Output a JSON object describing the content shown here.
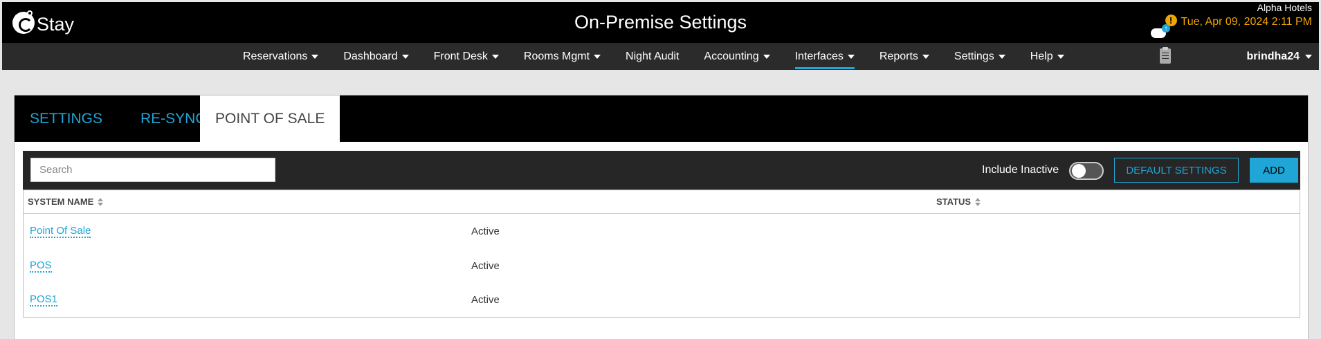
{
  "header": {
    "logo_text": "Stay",
    "title": "On-Premise Settings",
    "hotel": "Alpha Hotels",
    "datetime": "Tue, Apr 09, 2024 2:11 PM",
    "warning_glyph": "!",
    "accent_color": "#1fa5d6",
    "date_color": "#f0a500"
  },
  "nav": {
    "items": [
      {
        "label": "Reservations"
      },
      {
        "label": "Dashboard"
      },
      {
        "label": "Front Desk"
      },
      {
        "label": "Rooms Mgmt"
      },
      {
        "label": "Night Audit"
      },
      {
        "label": "Accounting"
      },
      {
        "label": "Interfaces"
      },
      {
        "label": "Reports"
      },
      {
        "label": "Settings"
      },
      {
        "label": "Help"
      }
    ],
    "user": "brindha24"
  },
  "tabs": [
    {
      "label": "SETTINGS"
    },
    {
      "label": "RE-SYNC"
    },
    {
      "label": "POINT OF SALE"
    }
  ],
  "toolbar": {
    "search_placeholder": "Search",
    "search_value": "",
    "include_inactive_label": "Include Inactive",
    "include_inactive": false,
    "default_settings_label": "DEFAULT SETTINGS",
    "add_label": "ADD"
  },
  "table": {
    "columns": [
      "SYSTEM NAME",
      "STATUS"
    ],
    "rows": [
      {
        "name": "Point Of Sale",
        "status": "Active"
      },
      {
        "name": "POS",
        "status": "Active"
      },
      {
        "name": "POS1",
        "status": "Active"
      }
    ]
  }
}
